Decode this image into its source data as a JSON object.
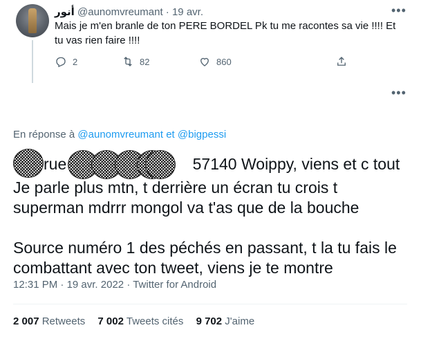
{
  "previous_tweet": {
    "display_name": "أنور",
    "handle": "@aunomvreumant",
    "separator": "·",
    "date": "19 avr.",
    "text": "Mais je m'en branle de ton PERE BORDEL Pk tu me racontes sa vie !!!! Et tu vas rien faire !!!!",
    "counts": {
      "replies": "2",
      "retweets": "82",
      "likes": "860"
    }
  },
  "main_tweet": {
    "reply_prefix": "En réponse à",
    "reply_mention_1": "@aunomvreumant",
    "reply_conjunction": "et",
    "reply_mention_2": "@bigpessi",
    "line_1_fragment_a": "rue",
    "line_1_fragment_b": "57140 Woippy, viens et c tout",
    "line_2": "Je parle plus mtn, t derrière un écran tu crois t",
    "line_3": "superman mdrrr mongol va t'as que de la bouche",
    "line_4": "Source numéro 1 des péchés en passant, t la tu fais le",
    "line_5": "combattant avec ton tweet, viens je te montre",
    "time": "12:31 PM",
    "date": "19 avr. 2022",
    "source": "Twitter for Android",
    "separator": "·"
  },
  "stats": {
    "retweets_count": "2 007",
    "retweets_label": "Retweets",
    "quotes_count": "7 002",
    "quotes_label": "Tweets cités",
    "likes_count": "9 702",
    "likes_label": "J'aime"
  },
  "icons": [
    "reply-icon",
    "retweet-icon",
    "like-icon",
    "share-icon",
    "more-icon"
  ],
  "colors": {
    "link": "#1d9bf0",
    "secondary_text": "#536471",
    "primary_text": "#0f1419",
    "divider": "#eff3f4"
  }
}
